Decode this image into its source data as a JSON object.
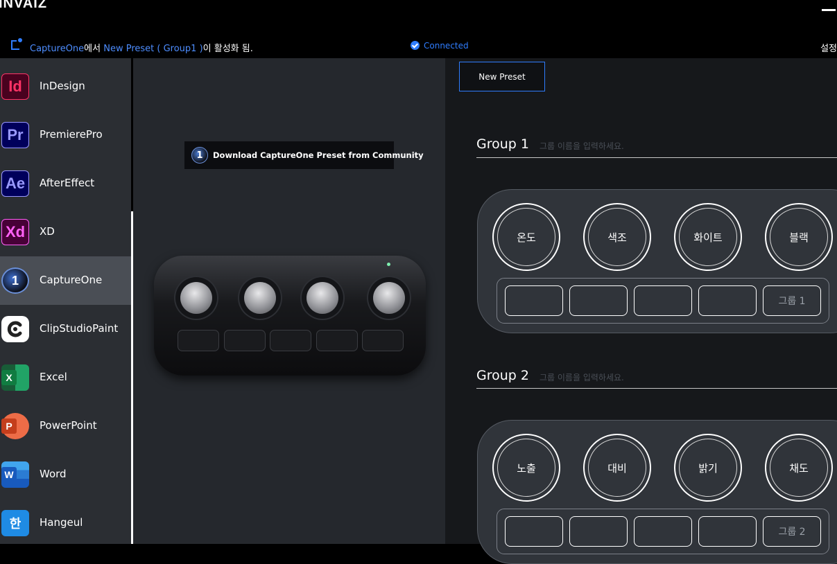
{
  "brand": "INVAIZ",
  "status": {
    "app": "CaptureOne",
    "text_a": "에서 ",
    "preset": "New Preset ( Group1 )",
    "text_b": "이 활성화 됨.",
    "connected": "Connected",
    "settings": "설정"
  },
  "sidebar": {
    "items": [
      {
        "label": "InDesign",
        "icon": "Id"
      },
      {
        "label": "PremierePro",
        "icon": "Pr"
      },
      {
        "label": "AfterEffect",
        "icon": "Ae"
      },
      {
        "label": "XD",
        "icon": "Xd"
      },
      {
        "label": "CaptureOne",
        "icon": "1",
        "active": true
      },
      {
        "label": "ClipStudioPaint",
        "icon": "clip-studio-icon"
      },
      {
        "label": "Excel",
        "icon": "X"
      },
      {
        "label": "PowerPoint",
        "icon": "P"
      },
      {
        "label": "Word",
        "icon": "W"
      },
      {
        "label": "Hangeul",
        "icon": "한"
      }
    ]
  },
  "middle": {
    "download_label": "Download CaptureOne Preset from Community",
    "download_icon": "1"
  },
  "right": {
    "new_preset_label": "New Preset",
    "name_placeholder": "그룹 이름을 입력하세요.",
    "groups": [
      {
        "title": "Group 1",
        "dials": [
          "온도",
          "색조",
          "화이트",
          "블랙"
        ],
        "group_key": "그룹 1"
      },
      {
        "title": "Group 2",
        "dials": [
          "노출",
          "대비",
          "밝기",
          "채도"
        ],
        "group_key": "그룹 2"
      }
    ]
  },
  "colors": {
    "accent": "#2f7dff",
    "background": "#000000",
    "sidebar_bg": "#2b2e33",
    "sidebar_active": "#4a4e55"
  }
}
